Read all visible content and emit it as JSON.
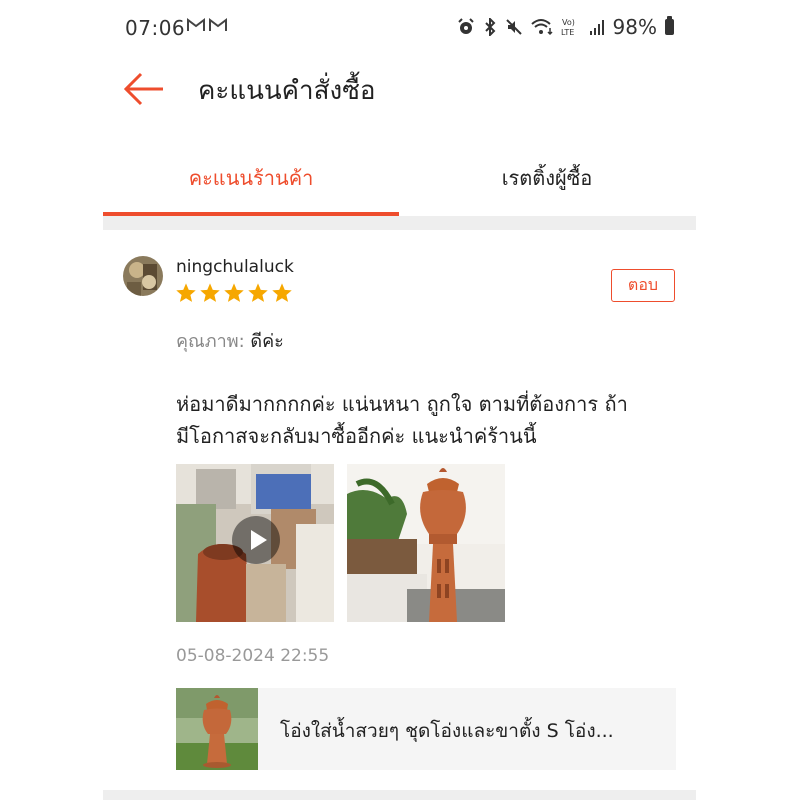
{
  "status_bar": {
    "time": "07:06",
    "battery": "98%",
    "icons": [
      "gmail-icon",
      "gmail-icon",
      "alarm-icon",
      "bluetooth-icon",
      "mute-icon",
      "wifi-icon",
      "volte-icon",
      "signal-icon",
      "battery-icon"
    ]
  },
  "header": {
    "back_icon": "back-arrow-icon",
    "title": "คะแนนคำสั่งซื้อ"
  },
  "tabs": [
    {
      "label": "คะแนนร้านค้า",
      "active": true
    },
    {
      "label": "เรตติ้งผู้ซื้อ",
      "active": false
    }
  ],
  "review": {
    "username": "ningchulaluck",
    "rating": 5,
    "reply_label": "ตอบ",
    "quality_label": "คุณภาพ:",
    "quality_value": "ดีค่ะ",
    "comment_line1": "ห่อมาดีมากกกกค่ะ แน่นหนา ถูกใจ ตามที่ต้องการ ถ้า",
    "comment_line2": "มีโอกาสจะกลับมาซื้ออีกค่ะ แนะนำค่ร้านนี้",
    "media": [
      {
        "type": "video",
        "icon": "play-icon"
      },
      {
        "type": "photo"
      }
    ],
    "date": "05-08-2024 22:55"
  },
  "product": {
    "title": "โอ่งใส่น้ำสวยๆ ชุดโอ่งและขาตั้ง S โอ่ง..."
  },
  "colors": {
    "accent": "#ee4d2d",
    "star": "#f6a700",
    "separator": "#eeeeee",
    "muted_text": "#999999"
  }
}
